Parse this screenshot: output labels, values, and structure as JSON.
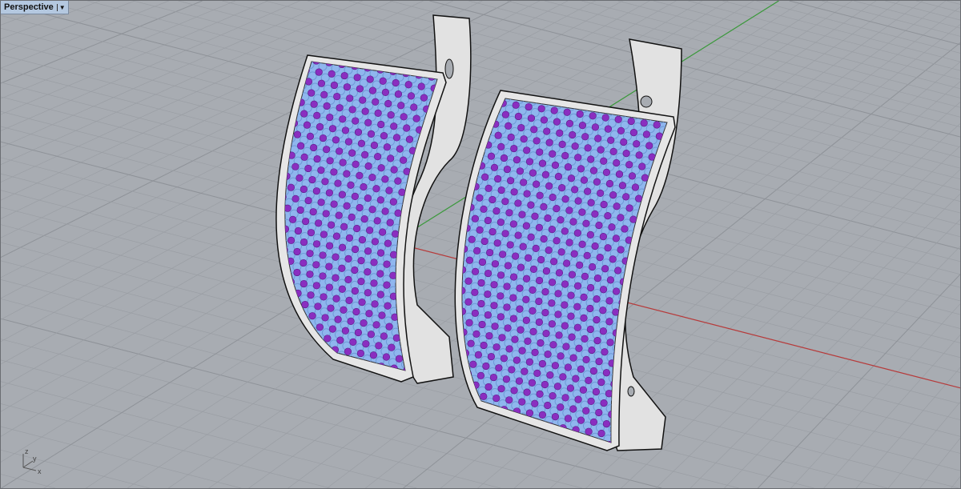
{
  "viewport": {
    "name": "Perspective",
    "menu_icon": "dropdown-triangle-icon",
    "axis_labels": {
      "x": "x",
      "y": "y",
      "z": "z"
    }
  },
  "colors": {
    "background": "#a8acb2",
    "grid": "#9a9ea4",
    "grid_major": "#8e9298",
    "x_axis": "#b83a3a",
    "y_axis": "#3a9a3a",
    "metal": "#e4e4e4",
    "panel": "#8fb6ee",
    "gem": "#8a2ec0"
  }
}
